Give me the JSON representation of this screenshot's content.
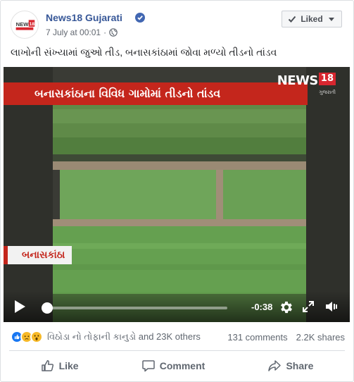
{
  "post": {
    "page_name": "News18 Gujarati",
    "date": "7 July at 00:01",
    "liked_label": "Liked",
    "text": "લાખોની સંખ્યામાં જુઓ તીડ, બનાસકાંઠામાં જોવા મળ્યો તીડનો તાંડવ",
    "avatar_logo": "NEWS18",
    "avatar_logo_sub": "ગુજરાતી"
  },
  "video": {
    "banner_text": "બનાસકાંઠાના વિવિધ ગામોમાં તીડનો તાંડવ",
    "logo_news": "NEWS",
    "logo_18": "18",
    "logo_sub": "ગુજરાતી",
    "location_tag": "બનાસકાંઠા",
    "time_remaining": "-0:38",
    "progress": 0.02
  },
  "engagement": {
    "reactors": "વિઠોડા નો તોફાની કાનુડો and 23K others",
    "comments": "131 comments",
    "shares": "2.2K shares",
    "reaction_icons": [
      "like-reaction-icon",
      "sad-reaction-icon",
      "wow-reaction-icon"
    ]
  },
  "actions": {
    "like": "Like",
    "comment": "Comment",
    "share": "Share"
  },
  "colors": {
    "link": "#385898",
    "banner": "#c4261c",
    "like_blue": "#1877f2",
    "reaction_yellow": "#f7b928"
  }
}
